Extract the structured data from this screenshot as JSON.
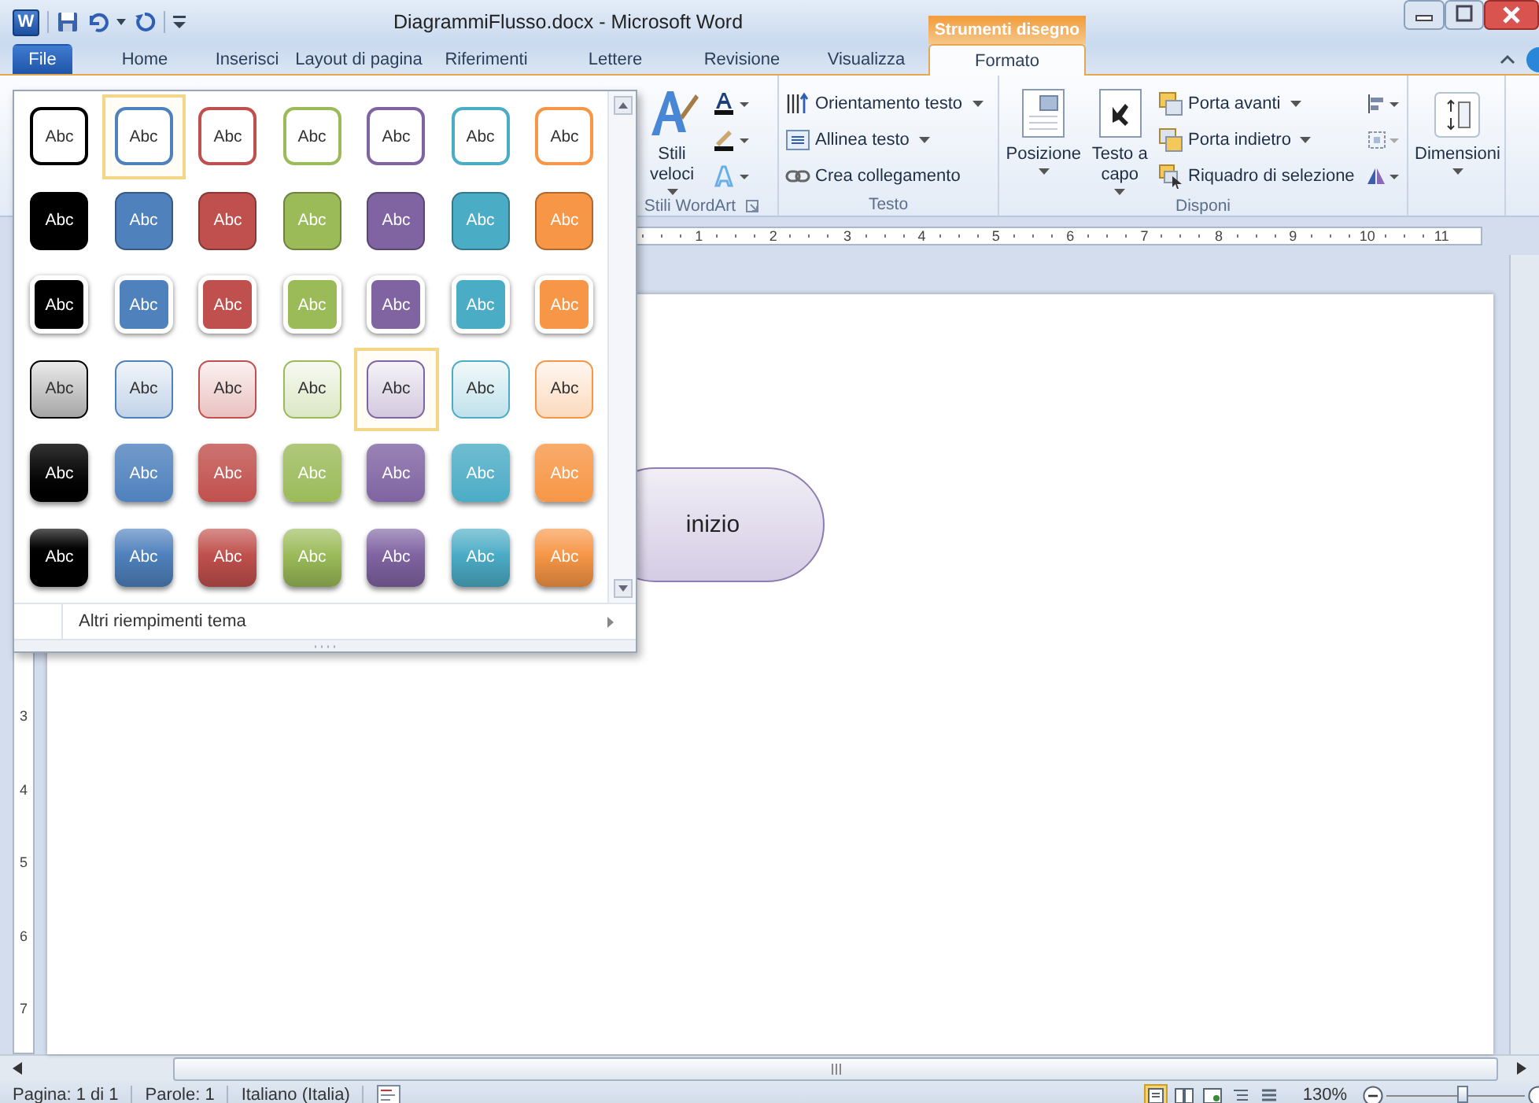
{
  "title_bar": {
    "logo": "W",
    "title": "DiagrammiFlusso.docx - Microsoft Word",
    "context_label": "Strumenti disegno"
  },
  "tabs": [
    {
      "label": "File",
      "kind": "file",
      "selected": false
    },
    {
      "label": "Home",
      "kind": "tab",
      "selected": false
    },
    {
      "label": "Inserisci",
      "kind": "tab",
      "selected": false
    },
    {
      "label": "Layout di pagina",
      "kind": "tab",
      "selected": false
    },
    {
      "label": "Riferimenti",
      "kind": "tab",
      "selected": false
    },
    {
      "label": "Lettere",
      "kind": "tab",
      "selected": false
    },
    {
      "label": "Revisione",
      "kind": "tab",
      "selected": false
    },
    {
      "label": "Visualizza",
      "kind": "tab",
      "selected": false
    },
    {
      "label": "Formato",
      "kind": "tab",
      "selected": true
    }
  ],
  "ribbon": [
    {
      "kind": "wordart",
      "label": "Stili WordArt",
      "buttons": [
        {
          "label": "Stili veloci",
          "menu": true
        }
      ]
    },
    {
      "kind": "text",
      "label": "Testo",
      "buttons": [
        {
          "label": "Orientamento testo",
          "menu": true
        },
        {
          "label": "Allinea testo",
          "menu": true
        },
        {
          "label": "Crea collegamento",
          "menu": false
        }
      ]
    },
    {
      "kind": "arrange",
      "label": "Disponi",
      "buttons": [
        {
          "label": "Posizione",
          "menu": true
        },
        {
          "label": "Testo a capo",
          "menu": true
        },
        {
          "label": "Porta avanti",
          "menu": true
        },
        {
          "label": "Porta indietro",
          "menu": true
        },
        {
          "label": "Riquadro di selezione",
          "menu": false
        }
      ]
    },
    {
      "kind": "size",
      "buttons": [
        {
          "label": "Dimensioni",
          "menu": true
        }
      ]
    }
  ],
  "rulers": {
    "horizontal": [
      "1",
      "2",
      "3",
      "4",
      "5",
      "6",
      "7",
      "8",
      "9",
      "10",
      "11"
    ],
    "vertical": [
      "3",
      "4",
      "5",
      "6",
      "7"
    ]
  },
  "document": {
    "shapes": [
      {
        "kind": "terminal",
        "label": "inizio"
      }
    ]
  },
  "gallery": {
    "rows": [
      {
        "kind": "outline",
        "items": [
          {
            "label": "Abc",
            "color": "#000000",
            "selected": false
          },
          {
            "label": "Abc",
            "color": "#4f81bd",
            "selected": true
          },
          {
            "label": "Abc",
            "color": "#c0504d",
            "selected": false
          },
          {
            "label": "Abc",
            "color": "#9bbb59",
            "selected": false
          },
          {
            "label": "Abc",
            "color": "#8064a2",
            "selected": false
          },
          {
            "label": "Abc",
            "color": "#4bacc6",
            "selected": false
          },
          {
            "label": "Abc",
            "color": "#f79646",
            "selected": false
          }
        ]
      },
      {
        "kind": "fill",
        "items": [
          {
            "label": "Abc",
            "color": "#000000",
            "selected": false
          },
          {
            "label": "Abc",
            "color": "#4f81bd",
            "selected": false
          },
          {
            "label": "Abc",
            "color": "#c0504d",
            "selected": false
          },
          {
            "label": "Abc",
            "color": "#9bbb59",
            "selected": false
          },
          {
            "label": "Abc",
            "color": "#8064a2",
            "selected": false
          },
          {
            "label": "Abc",
            "color": "#4bacc6",
            "selected": false
          },
          {
            "label": "Abc",
            "color": "#f79646",
            "selected": false
          }
        ]
      },
      {
        "kind": "fill-border",
        "items": [
          {
            "label": "Abc",
            "color": "#000000",
            "selected": false
          },
          {
            "label": "Abc",
            "color": "#4f81bd",
            "selected": false
          },
          {
            "label": "Abc",
            "color": "#c0504d",
            "selected": false
          },
          {
            "label": "Abc",
            "color": "#9bbb59",
            "selected": false
          },
          {
            "label": "Abc",
            "color": "#8064a2",
            "selected": false
          },
          {
            "label": "Abc",
            "color": "#4bacc6",
            "selected": false
          },
          {
            "label": "Abc",
            "color": "#f79646",
            "selected": false
          }
        ]
      },
      {
        "kind": "light",
        "items": [
          {
            "label": "Abc",
            "color": "#000000",
            "selected": false
          },
          {
            "label": "Abc",
            "color": "#4f81bd",
            "selected": false
          },
          {
            "label": "Abc",
            "color": "#c0504d",
            "selected": false
          },
          {
            "label": "Abc",
            "color": "#9bbb59",
            "selected": false
          },
          {
            "label": "Abc",
            "color": "#8064a2",
            "selected": true
          },
          {
            "label": "Abc",
            "color": "#4bacc6",
            "selected": false
          },
          {
            "label": "Abc",
            "color": "#f79646",
            "selected": false
          }
        ]
      },
      {
        "kind": "intense",
        "items": [
          {
            "label": "Abc",
            "color": "#000000",
            "selected": false
          },
          {
            "label": "Abc",
            "color": "#4f81bd",
            "selected": false
          },
          {
            "label": "Abc",
            "color": "#c0504d",
            "selected": false
          },
          {
            "label": "Abc",
            "color": "#9bbb59",
            "selected": false
          },
          {
            "label": "Abc",
            "color": "#8064a2",
            "selected": false
          },
          {
            "label": "Abc",
            "color": "#4bacc6",
            "selected": false
          },
          {
            "label": "Abc",
            "color": "#f79646",
            "selected": false
          }
        ]
      },
      {
        "kind": "bevel",
        "items": [
          {
            "label": "Abc",
            "color": "#000000",
            "selected": false
          },
          {
            "label": "Abc",
            "color": "#4f81bd",
            "selected": false
          },
          {
            "label": "Abc",
            "color": "#c0504d",
            "selected": false
          },
          {
            "label": "Abc",
            "color": "#9bbb59",
            "selected": false
          },
          {
            "label": "Abc",
            "color": "#8064a2",
            "selected": false
          },
          {
            "label": "Abc",
            "color": "#4bacc6",
            "selected": false
          },
          {
            "label": "Abc",
            "color": "#f79646",
            "selected": false
          }
        ]
      }
    ],
    "footer": "Altri riempimenti tema"
  },
  "status_bar": {
    "items": [
      "Pagina: 1 di 1",
      "Parole: 1",
      "Italiano (Italia)"
    ],
    "views": [
      {
        "selected": true
      },
      {
        "selected": false
      },
      {
        "selected": false
      },
      {
        "selected": false
      },
      {
        "selected": false
      }
    ],
    "zoom": "130%",
    "zoom_slider": {
      "level": 0.55
    }
  }
}
